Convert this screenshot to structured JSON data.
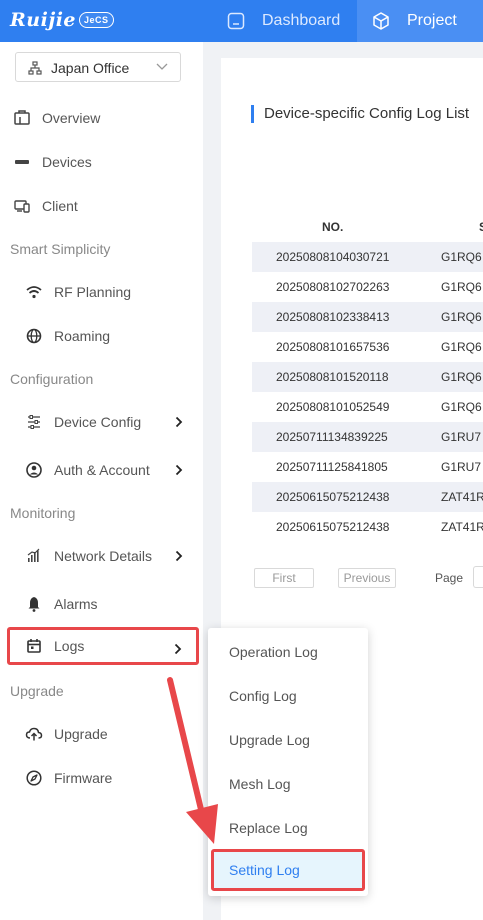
{
  "header": {
    "logo_text": "Ruijie",
    "logo_badge": "JeCS",
    "tabs": [
      {
        "label": "Dashboard",
        "icon": "dashboard-icon",
        "active": false
      },
      {
        "label": "Project",
        "icon": "project-cube-icon",
        "active": true
      }
    ]
  },
  "sidebar": {
    "site_selector": {
      "value": "Japan Office",
      "icon": "network-topology-icon"
    },
    "items": [
      {
        "label": "Overview",
        "icon": "overview-icon"
      },
      {
        "label": "Devices",
        "icon": "devices-icon"
      },
      {
        "label": "Client",
        "icon": "client-icon"
      }
    ],
    "groups": {
      "smart": "Smart Simplicity",
      "configuration": "Configuration",
      "monitoring": "Monitoring",
      "upgrade": "Upgrade"
    },
    "smart_items": [
      {
        "label": "RF Planning",
        "icon": "wifi-icon"
      },
      {
        "label": "Roaming",
        "icon": "globe-icon"
      }
    ],
    "config_items": [
      {
        "label": "Device Config",
        "icon": "sliders-icon"
      },
      {
        "label": "Auth & Account",
        "icon": "user-circle-icon"
      }
    ],
    "monitor_items": [
      {
        "label": "Network Details",
        "icon": "signal-bars-icon"
      },
      {
        "label": "Alarms",
        "icon": "bell-icon"
      },
      {
        "label": "Logs",
        "icon": "calendar-icon"
      }
    ],
    "upgrade_items": [
      {
        "label": "Upgrade",
        "icon": "cloud-upload-icon"
      },
      {
        "label": "Firmware",
        "icon": "compass-icon"
      }
    ]
  },
  "main": {
    "title": "Device-specific Config Log List",
    "columns": [
      "NO.",
      "SN"
    ],
    "rows": [
      {
        "no": "20250808104030721",
        "sn": "G1RQ6"
      },
      {
        "no": "20250808102702263",
        "sn": "G1RQ6"
      },
      {
        "no": "20250808102338413",
        "sn": "G1RQ6"
      },
      {
        "no": "20250808101657536",
        "sn": "G1RQ6"
      },
      {
        "no": "20250808101520118",
        "sn": "G1RQ6"
      },
      {
        "no": "20250808101052549",
        "sn": "G1RQ6"
      },
      {
        "no": "20250711134839225",
        "sn": "G1RU7"
      },
      {
        "no": "20250711125841805",
        "sn": "G1RU7"
      },
      {
        "no": "20250615075212438",
        "sn": "ZAT41R"
      },
      {
        "no": "20250615075212438",
        "sn": "ZAT41R"
      }
    ],
    "pager": {
      "first": "First",
      "previous": "Previous",
      "page_label": "Page"
    }
  },
  "logs_submenu": [
    "Operation Log",
    "Config Log",
    "Upgrade Log",
    "Mesh Log",
    "Replace Log",
    "Setting Log"
  ],
  "colors": {
    "brand_blue": "#2f7ff0",
    "annotation_red": "#e8474a",
    "active_bg": "#e6f5fd"
  }
}
